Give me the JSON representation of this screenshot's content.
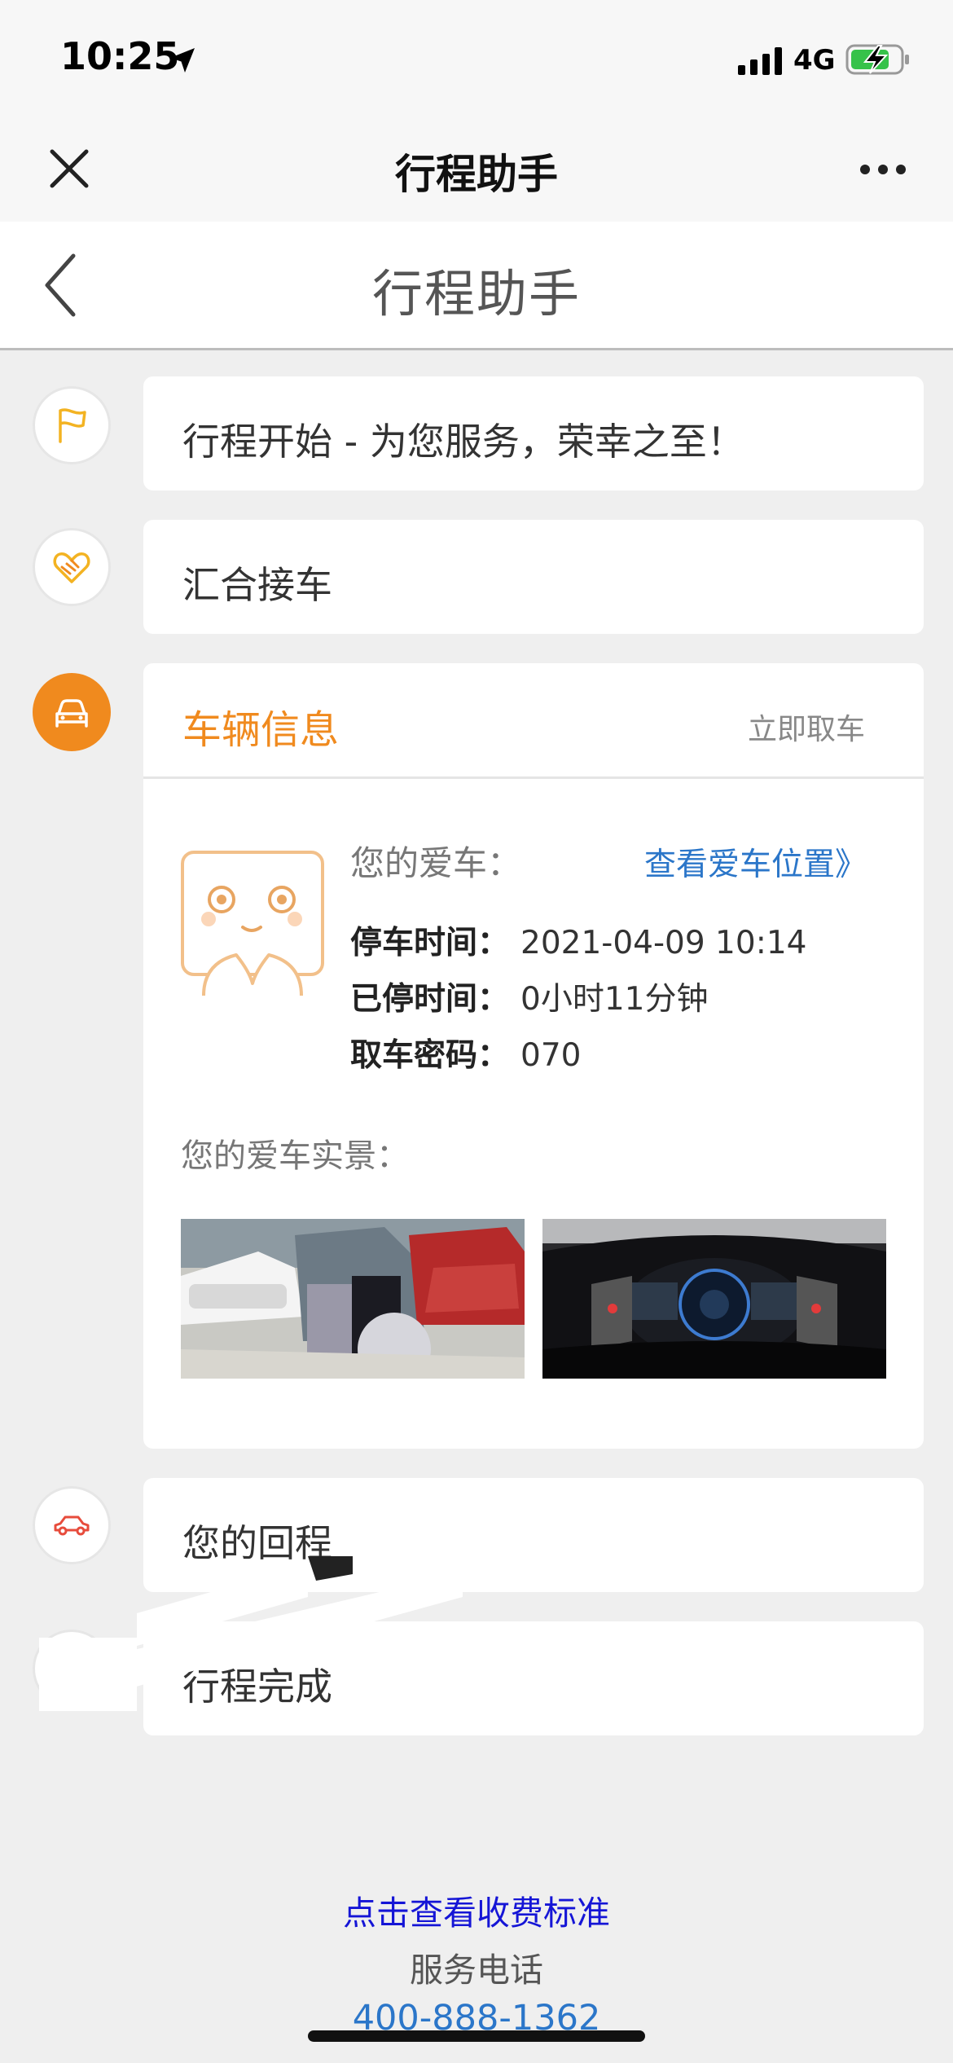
{
  "status_bar": {
    "time": "10:25",
    "network": "4G"
  },
  "nav": {
    "title": "行程助手"
  },
  "page": {
    "title": "行程助手"
  },
  "steps": {
    "start": "行程开始 - 为您服务，荣幸之至！",
    "meet": "汇合接车",
    "vehicle": {
      "title": "车辆信息",
      "pickup_action": "立即取车",
      "car_label": "您的爱车：",
      "location_link": "查看爱车位置》",
      "park_time_key": "停车时间：",
      "park_time_val": "2021-04-09 10:14",
      "parked_dur_key": "已停时间：",
      "parked_dur_val": "0小时11分钟",
      "code_key": "取车密码：",
      "code_val": "070",
      "photos_label": "您的爱车实景："
    },
    "return": "您的回程",
    "complete": "行程完成"
  },
  "footer": {
    "fee_link": "点击查看收费标准",
    "service_label": "服务电话",
    "phone": "400-888-1362"
  },
  "colors": {
    "accent": "#f08a1e",
    "link": "#2b76c9",
    "fee_link": "#1515d6"
  },
  "icons": [
    "location-arrow-icon",
    "signal-icon",
    "battery-charging-icon",
    "close-icon",
    "more-icon",
    "back-icon",
    "flag-icon",
    "handshake-icon",
    "car-icon",
    "car-outline-icon"
  ]
}
